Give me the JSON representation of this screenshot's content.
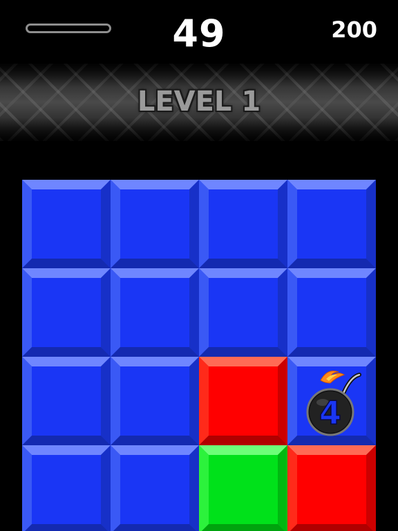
{
  "hud": {
    "progress": 0,
    "timer": "49",
    "score": "200"
  },
  "banner": {
    "level_text": "LEVEL 1"
  },
  "board": {
    "rows": [
      [
        "blue",
        "blue",
        "blue",
        "blue"
      ],
      [
        "blue",
        "blue",
        "blue",
        "blue"
      ],
      [
        "blue",
        "blue",
        "red",
        "blue"
      ],
      [
        "blue",
        "blue",
        "green",
        "red"
      ]
    ],
    "bomb": {
      "row": 2,
      "col": 3,
      "count": "4"
    }
  },
  "colors": {
    "blue": "#1a36f5",
    "red": "#ff0000",
    "green": "#00e11a",
    "background": "#000000"
  },
  "icons": {
    "bomb": "bomb-icon"
  }
}
